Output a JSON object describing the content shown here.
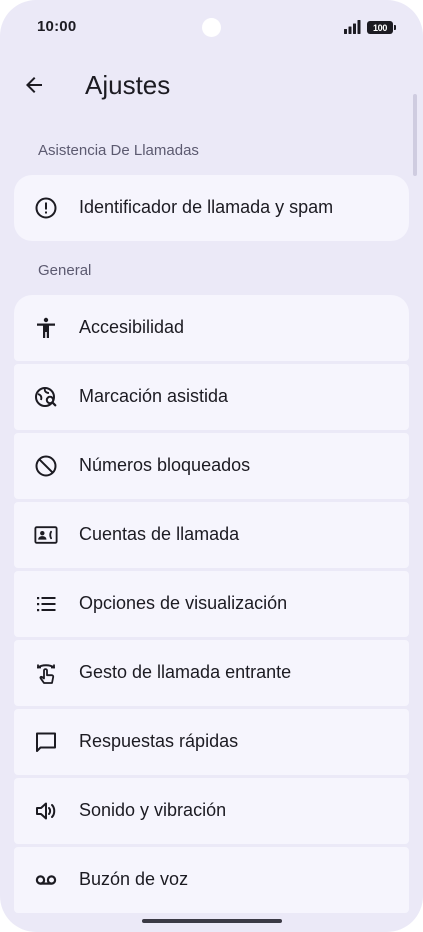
{
  "status_bar": {
    "time": "10:00",
    "battery": "100"
  },
  "app_bar": {
    "title": "Ajustes",
    "back_icon": "arrow-back-icon"
  },
  "sections": {
    "call_assist": {
      "header": "Asistencia De Llamadas",
      "items": [
        {
          "label": "Identificador de llamada y spam",
          "icon": "alert-circle-icon"
        }
      ]
    },
    "general": {
      "header": "General",
      "items": [
        {
          "label": "Accesibilidad",
          "icon": "accessibility-icon"
        },
        {
          "label": "Marcación asistida",
          "icon": "assisted-dialing-icon"
        },
        {
          "label": "Números bloqueados",
          "icon": "block-icon"
        },
        {
          "label": "Cuentas de llamada",
          "icon": "contact-card-icon"
        },
        {
          "label": "Opciones de visualización",
          "icon": "list-icon"
        },
        {
          "label": "Gesto de llamada entrante",
          "icon": "swipe-gesture-icon"
        },
        {
          "label": "Respuestas rápidas",
          "icon": "message-icon"
        },
        {
          "label": "Sonido y vibración",
          "icon": "volume-icon"
        },
        {
          "label": "Buzón de voz",
          "icon": "voicemail-icon"
        }
      ]
    }
  },
  "colors": {
    "background": "#ebe9f7",
    "card": "#f6f5fd",
    "text_primary": "#1c1b22",
    "text_secondary": "#5c5a70"
  }
}
